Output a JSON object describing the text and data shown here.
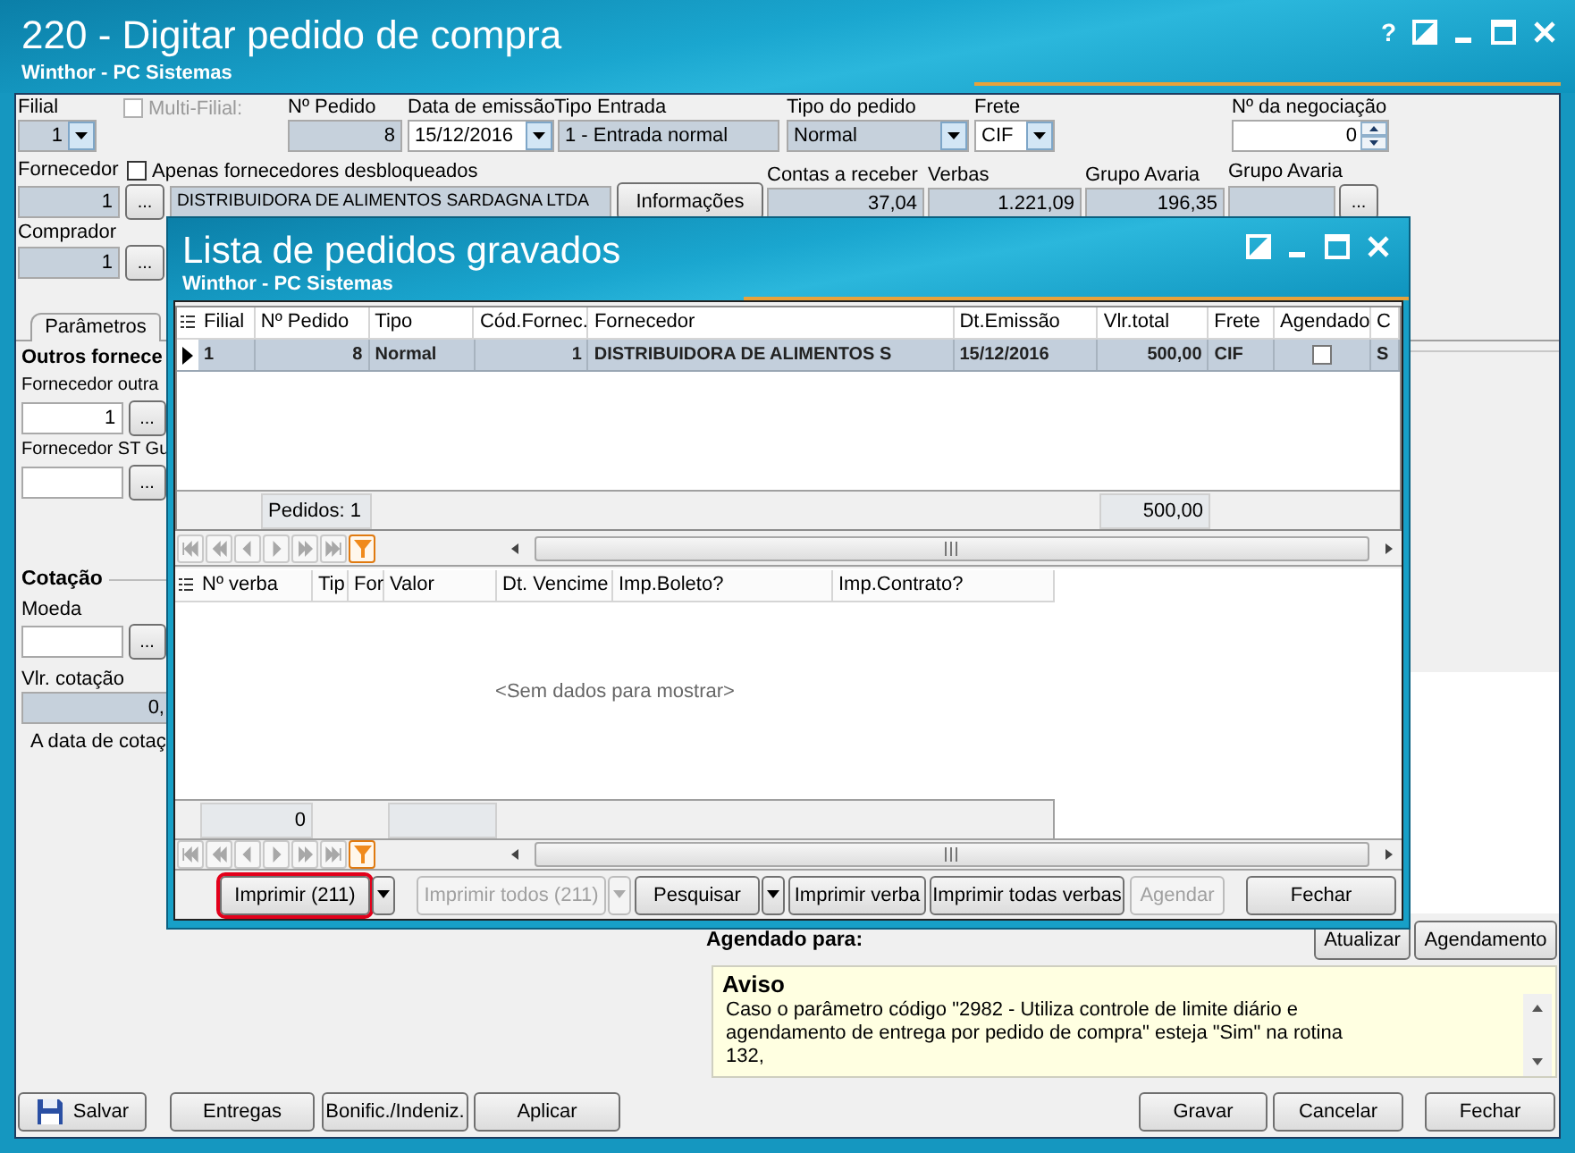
{
  "window": {
    "title": "220 - Digitar pedido de compra",
    "subtitle": "Winthor - PC Sistemas",
    "help": "?"
  },
  "form": {
    "filial": {
      "label": "Filial",
      "value": "1"
    },
    "multi_filial": {
      "label": "Multi-Filial:",
      "checked": false,
      "disabled": true
    },
    "numero_pedido": {
      "label": "Nº Pedido",
      "value": "8"
    },
    "data_emissao": {
      "label": "Data de emissão",
      "value": "15/12/2016"
    },
    "tipo_entrada": {
      "label": "Tipo Entrada",
      "value": "1 - Entrada normal"
    },
    "tipo_pedido": {
      "label": "Tipo do pedido",
      "value": "Normal"
    },
    "frete": {
      "label": "Frete",
      "value": "CIF"
    },
    "negociacao": {
      "label": "Nº da negociação",
      "value": "0"
    },
    "fornecedor": {
      "label": "Fornecedor",
      "code": "1",
      "lookup": "...",
      "name": "DISTRIBUIDORA DE ALIMENTOS SARDAGNA LTDA"
    },
    "desbloqueados": {
      "label": "Apenas fornecedores desbloqueados",
      "checked": false
    },
    "informacoes": "Informações",
    "totals": [
      {
        "label": "Contas a receber",
        "value": "37,04"
      },
      {
        "label": "Verbas",
        "value": "1.221,09"
      },
      {
        "label": "Grupo Avaria",
        "value": "196,35"
      }
    ],
    "grupo_avaria_lookup": {
      "label": "Grupo Avaria",
      "lookup": "..."
    },
    "comprador": {
      "label": "Comprador",
      "value": "1",
      "lookup": "..."
    }
  },
  "tabs": [
    {
      "label": "Parâmetros",
      "selected": true
    }
  ],
  "parametros": {
    "title": "Outros fornece",
    "fields": [
      {
        "label": "Fornecedor outra",
        "value": "1",
        "lookup": "..."
      },
      {
        "label": "Fornecedor ST Gu",
        "lookup": "..."
      }
    ],
    "cotacao": {
      "title": "Cotação",
      "moeda": {
        "label": "Moeda",
        "lookup": "..."
      },
      "valor": {
        "label": "Vlr. cotação",
        "value": "0,"
      },
      "note": "A data de cotaç"
    }
  },
  "agendamento": {
    "label": "Agendado para:",
    "buttons": [
      "Atualizar",
      "Agendamento"
    ]
  },
  "aviso": {
    "title": "Aviso",
    "lines": [
      "Caso o parâmetro código \"2982 - Utiliza controle de limite diário e",
      "agendamento de entrega por pedido de compra\" esteja \"Sim\" na rotina",
      "132,"
    ]
  },
  "actions_left": [
    {
      "label": "Salvar",
      "icon": true
    },
    {
      "label": "Entregas",
      "icon": false
    },
    {
      "label": "Bonific./Indeniz.",
      "icon": false
    },
    {
      "label": "Aplicar",
      "icon": false
    }
  ],
  "actions_right": [
    "Gravar",
    "Cancelar",
    "Fechar"
  ],
  "dialog": {
    "title": "Lista de pedidos gravados",
    "subtitle": "Winthor - PC Sistemas",
    "orders": {
      "columns": [
        {
          "label": "Filial",
          "kind": "text"
        },
        {
          "label": "Nº Pedido",
          "kind": "number"
        },
        {
          "label": "Tipo",
          "kind": "text"
        },
        {
          "label": "Cód.Fornec.",
          "kind": "number"
        },
        {
          "label": "Fornecedor",
          "kind": "text"
        },
        {
          "label": "Dt.Emissão",
          "kind": "text"
        },
        {
          "label": "Vlr.total",
          "kind": "number"
        },
        {
          "label": "Frete",
          "kind": "text"
        },
        {
          "label": "Agendado",
          "kind": "check"
        },
        {
          "label": "C",
          "kind": "text"
        }
      ],
      "rows": [
        {
          "selected": true,
          "cells": [
            "1",
            "8",
            "Normal",
            "1",
            "DISTRIBUIDORA DE ALIMENTOS S",
            "15/12/2016",
            "500,00",
            "CIF",
            false,
            "S"
          ]
        }
      ],
      "count": "Pedidos: 1",
      "total": "500,00"
    },
    "verbas": {
      "columns": [
        "Nº verba",
        "Tip",
        "For",
        "Valor",
        "Dt. Vencime",
        "Imp.Boleto?",
        "Imp.Contrato?"
      ],
      "empty": "<Sem dados para mostrar>",
      "count": "0"
    },
    "buttons": [
      {
        "label": "Imprimir (211)",
        "disabled": false,
        "highlighted": true,
        "dropdown": true
      },
      {
        "label": "Imprimir todos (211)",
        "disabled": true,
        "highlighted": false,
        "dropdown": true
      },
      {
        "label": "Pesquisar",
        "disabled": false,
        "highlighted": false,
        "dropdown": true
      },
      {
        "label": "Imprimir verba",
        "disabled": false,
        "highlighted": false,
        "dropdown": false
      },
      {
        "label": "Imprimir todas verbas",
        "disabled": false,
        "highlighted": false,
        "dropdown": false
      },
      {
        "label": "Agendar",
        "disabled": true,
        "highlighted": false,
        "dropdown": false
      },
      {
        "label": "Fechar",
        "disabled": false,
        "highlighted": false,
        "dropdown": false
      }
    ]
  }
}
